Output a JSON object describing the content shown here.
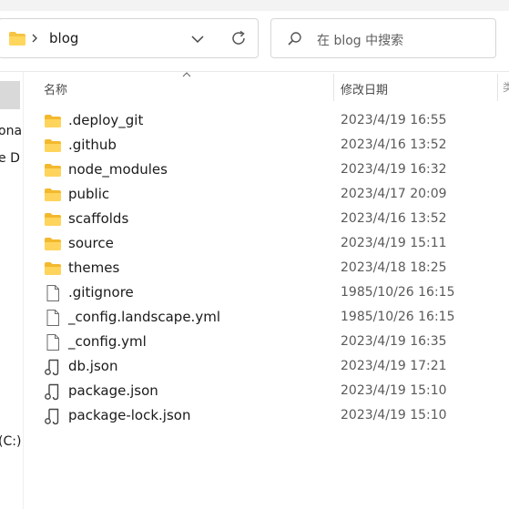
{
  "address": {
    "folder_name": "blog"
  },
  "search": {
    "placeholder": "在 blog 中搜索"
  },
  "columns": {
    "name": "名称",
    "modified": "修改日期"
  },
  "nav": {
    "fragments": [
      "ona",
      "e D",
      "(C:)"
    ]
  },
  "files": [
    {
      "name": ".deploy_git",
      "modified": "2023/4/19 16:55",
      "type": "folder"
    },
    {
      "name": ".github",
      "modified": "2023/4/16 13:52",
      "type": "folder"
    },
    {
      "name": "node_modules",
      "modified": "2023/4/19 16:32",
      "type": "folder"
    },
    {
      "name": "public",
      "modified": "2023/4/17 20:09",
      "type": "folder"
    },
    {
      "name": "scaffolds",
      "modified": "2023/4/16 13:52",
      "type": "folder"
    },
    {
      "name": "source",
      "modified": "2023/4/19 15:11",
      "type": "folder"
    },
    {
      "name": "themes",
      "modified": "2023/4/18 18:25",
      "type": "folder"
    },
    {
      "name": ".gitignore",
      "modified": "1985/10/26 16:15",
      "type": "file"
    },
    {
      "name": "_config.landscape.yml",
      "modified": "1985/10/26 16:15",
      "type": "file"
    },
    {
      "name": "_config.yml",
      "modified": "2023/4/19 16:35",
      "type": "file"
    },
    {
      "name": "db.json",
      "modified": "2023/4/19 17:21",
      "type": "json"
    },
    {
      "name": "package.json",
      "modified": "2023/4/19 15:10",
      "type": "json"
    },
    {
      "name": "package-lock.json",
      "modified": "2023/4/19 15:10",
      "type": "json"
    }
  ]
}
